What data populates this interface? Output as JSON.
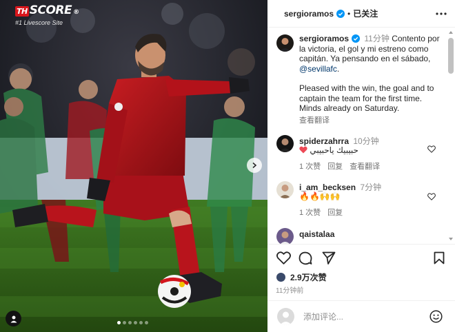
{
  "watermark": {
    "brand_th": "TH",
    "brand_score": "SCORE",
    "reg": "®",
    "tagline": "#1 Livescore Site"
  },
  "carousel": {
    "slides": 6,
    "active_index": 0
  },
  "header": {
    "username": "sergioramos",
    "separator": "•",
    "follow_label": "已关注"
  },
  "caption": {
    "username": "sergioramos",
    "time": "11分钟",
    "line_es_1": "Contento por la victoria, el gol y mi estreno como capitán. Ya pensando en el sábado,",
    "mention": "@sevillafc",
    "line_es_end": ".",
    "line_en": "Pleased with the win, the goal and to captain the team for the first time. Minds already on Saturday.",
    "see_translation": "查看翻译"
  },
  "comments": [
    {
      "username": "spiderzahrra",
      "time": "10分钟",
      "text": "حبيبيك ياحبيبي",
      "likes": "1 次赞",
      "reply": "回复",
      "translate": "查看翻译"
    },
    {
      "username": "i_am_becksen",
      "time": "7分钟",
      "text": "🔥🔥🙌🙌",
      "likes": "1 次赞",
      "reply": "回复"
    },
    {
      "username": "qaistalaa"
    }
  ],
  "likes_count": "2.9万次赞",
  "posted_ago": "11分钟前",
  "add_comment": {
    "placeholder": "添加评论..."
  },
  "colors": {
    "verified": "#0095f6",
    "mention": "#00376b",
    "heart_red": "#ed4956",
    "kit_red": "#b3121a"
  },
  "icons": [
    "verified-icon",
    "more-icon",
    "heart-icon",
    "comment-icon",
    "share-icon",
    "bookmark-icon",
    "smile-icon",
    "chevron-right-icon",
    "user-tag-icon"
  ]
}
